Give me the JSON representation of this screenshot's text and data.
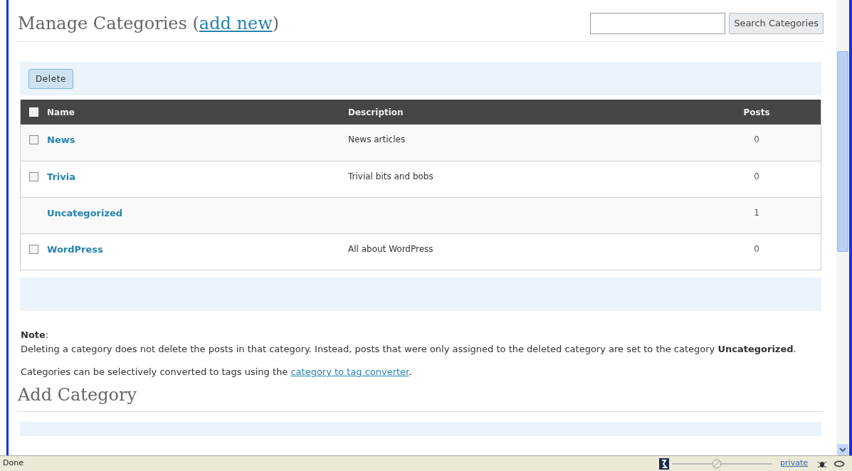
{
  "page": {
    "title": "Manage Categories (",
    "title_link": "add new",
    "title_end": ")",
    "search": {
      "button": "Search Categories"
    }
  },
  "bulk_action": "Delete",
  "table": {
    "select_all": {
      "checked": false
    },
    "columns": [
      "Name",
      "Description",
      "Posts"
    ],
    "rows": [
      {
        "kind": "checkbox",
        "checked": false,
        "name": "News",
        "description": "News articles",
        "posts": "0"
      },
      {
        "kind": "checkbox",
        "checked": false,
        "name": "Trivia",
        "description": "Trivial bits and bobs",
        "posts": "0"
      },
      {
        "kind": "plain",
        "name": "Uncategorized",
        "description": "",
        "posts": "1"
      },
      {
        "kind": "checkbox",
        "checked": false,
        "name": "WordPress",
        "description": "All about WordPress",
        "posts": "0"
      }
    ]
  },
  "note": {
    "label": "**Note**:",
    "text": "Deleting a category does not delete the posts in that category. Instead, posts that were only assigned to the deleted category are set to the category **Uncategorized**.",
    "convert_text": "Categories can be selectively converted to tags using the ",
    "convert_link": "category to tag converter",
    "convert_end": "."
  },
  "add_title": "Add Category",
  "status_bar": {
    "text": "Done",
    "zoom": {
      "level": 0.45
    },
    "mode": "private"
  }
}
